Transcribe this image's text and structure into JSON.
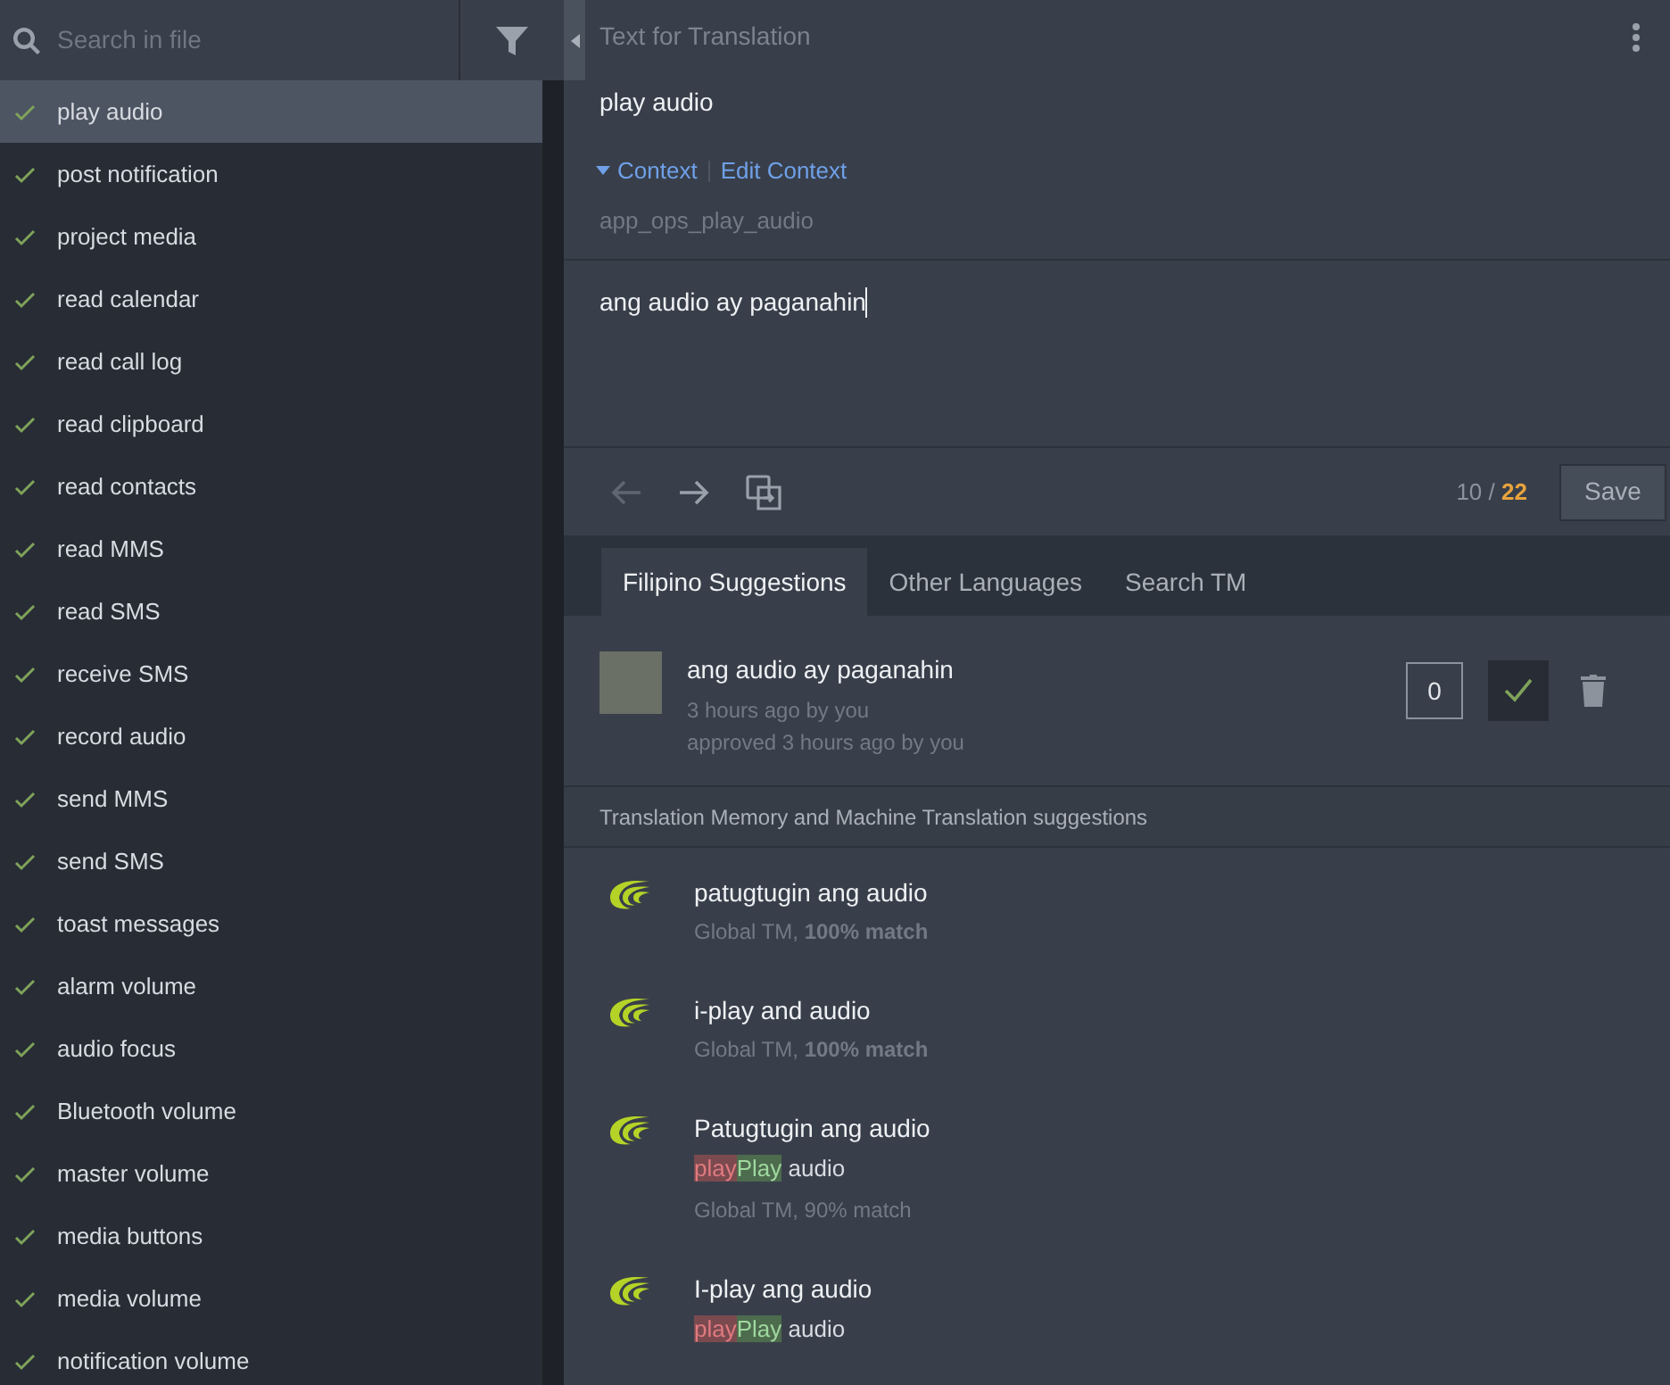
{
  "sidebar": {
    "search": {
      "placeholder": "Search in file"
    },
    "items": [
      {
        "label": "play audio",
        "approved": true,
        "selected": true
      },
      {
        "label": "post notification",
        "approved": true,
        "selected": false
      },
      {
        "label": "project media",
        "approved": true,
        "selected": false
      },
      {
        "label": "read calendar",
        "approved": true,
        "selected": false
      },
      {
        "label": "read call log",
        "approved": true,
        "selected": false
      },
      {
        "label": "read clipboard",
        "approved": true,
        "selected": false
      },
      {
        "label": "read contacts",
        "approved": true,
        "selected": false
      },
      {
        "label": "read MMS",
        "approved": true,
        "selected": false
      },
      {
        "label": "read SMS",
        "approved": true,
        "selected": false
      },
      {
        "label": "receive SMS",
        "approved": true,
        "selected": false
      },
      {
        "label": "record audio",
        "approved": true,
        "selected": false
      },
      {
        "label": "send MMS",
        "approved": true,
        "selected": false
      },
      {
        "label": "send SMS",
        "approved": true,
        "selected": false
      },
      {
        "label": "toast messages",
        "approved": true,
        "selected": false
      },
      {
        "label": "alarm volume",
        "approved": true,
        "selected": false
      },
      {
        "label": "audio focus",
        "approved": true,
        "selected": false
      },
      {
        "label": "Bluetooth volume",
        "approved": true,
        "selected": false
      },
      {
        "label": "master volume",
        "approved": true,
        "selected": false
      },
      {
        "label": "media buttons",
        "approved": true,
        "selected": false
      },
      {
        "label": "media volume",
        "approved": true,
        "selected": false
      },
      {
        "label": "notification volume",
        "approved": true,
        "selected": false
      }
    ]
  },
  "source": {
    "heading": "Text for Translation",
    "text": "play audio",
    "context_toggle": "Context",
    "edit_context": "Edit Context",
    "key": "app_ops_play_audio"
  },
  "translation": {
    "value": "ang audio ay paganahin"
  },
  "toolbar": {
    "current": "10",
    "separator": "/",
    "total": "22",
    "save": "Save"
  },
  "tabs": [
    {
      "label": "Filipino Suggestions",
      "selected": true
    },
    {
      "label": "Other Languages",
      "selected": false
    },
    {
      "label": "Search TM",
      "selected": false
    }
  ],
  "suggestions": [
    {
      "text": "ang audio ay paganahin",
      "meta": "3 hours ago by you",
      "approval": "approved 3 hours ago by you",
      "votes": "0",
      "approved": true
    }
  ],
  "tm_heading": "Translation Memory and Machine Translation suggestions",
  "tm_items": [
    {
      "text": "patugtugin ang audio",
      "meta": "Global TM, **100% match**"
    },
    {
      "text": "i-play and audio",
      "meta": "Global TM, **100% match**"
    },
    {
      "text": "Patugtugin ang audio",
      "diff": [
        {
          "text": "play",
          "kind": "removed"
        },
        {
          "text": "Play",
          "kind": "added"
        },
        {
          "text": " audio",
          "kind": "same"
        }
      ],
      "meta": "Global TM, 90% match"
    },
    {
      "text": "I-play ang audio",
      "diff": [
        {
          "text": "play",
          "kind": "removed"
        },
        {
          "text": "Play",
          "kind": "added"
        },
        {
          "text": " audio",
          "kind": "same"
        }
      ]
    }
  ]
}
